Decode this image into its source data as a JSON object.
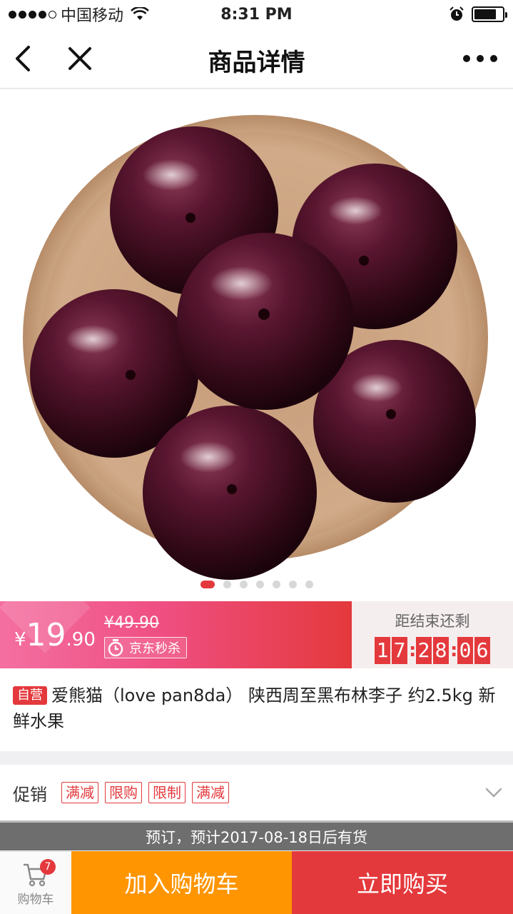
{
  "status_bar": {
    "carrier": "中国移动",
    "time": "8:31 PM",
    "signal_bars_filled": 4,
    "signal_bars_total": 5,
    "battery_level": 0.8
  },
  "nav": {
    "title": "商品详情",
    "back_icon": "chevron-left-icon",
    "close_icon": "close-icon",
    "more_icon": "more-dots-icon"
  },
  "gallery": {
    "image_subject": "black plums in a wooden bowl",
    "page_count": 7,
    "active_page": 1
  },
  "price": {
    "currency": "¥",
    "integer": "19",
    "decimal": ".90",
    "original": "¥49.90",
    "seckill_label": "京东秒杀",
    "countdown_label": "距结束还剩",
    "countdown": [
      "17",
      "28",
      "06"
    ]
  },
  "product": {
    "self_tag": "自营",
    "title": "爱熊猫（love pan8da） 陕西周至黑布林李子 约2.5kg 新鲜水果"
  },
  "promo": {
    "label": "促销",
    "tags": [
      "满减",
      "限购",
      "限制",
      "满减"
    ]
  },
  "stock_notice": "预订，预计2017-08-18日后有货",
  "bottom_bar": {
    "cart_label": "购物车",
    "cart_count": "7",
    "add_to_cart": "加入购物车",
    "buy_now": "立即购买"
  },
  "colors": {
    "brand_red": "#e4393c",
    "orange": "#ff9500",
    "pink": "#f46fa0"
  }
}
